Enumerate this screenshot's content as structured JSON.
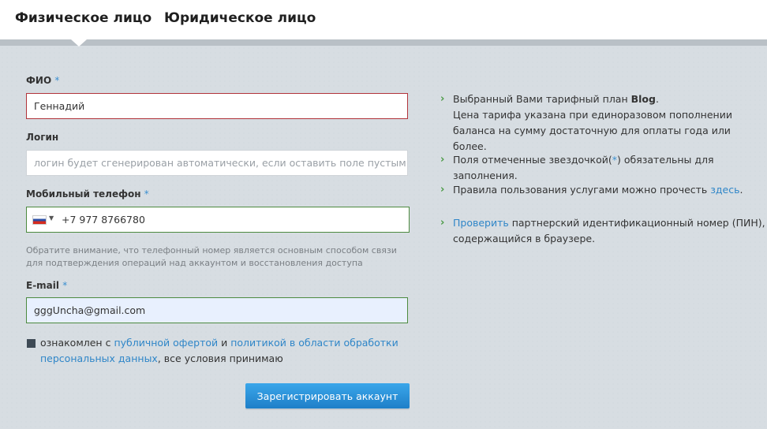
{
  "tabs": [
    {
      "label": "Физическое лицо",
      "active": true
    },
    {
      "label": "Юридическое лицо",
      "active": false
    }
  ],
  "form": {
    "required_mark": "*",
    "fio": {
      "label": "ФИО",
      "value": "Геннадий"
    },
    "login": {
      "label": "Логин",
      "value": "",
      "placeholder": "логин будет сгенерирован автоматически, если оставить поле пустым"
    },
    "phone": {
      "label": "Мобильный телефон",
      "value": "+7 977 8766780",
      "country_icon": "russia-flag-icon"
    },
    "phone_hint": "Обратите внимание, что телефонный номер является основным способом связи для подтверждения операций над аккаунтом и восстановления доступа",
    "email": {
      "label": "E-mail",
      "value": "gggUncha@gmail.com"
    },
    "agree": {
      "prefix": "ознакомлен с ",
      "link1": "публичной офертой",
      "mid": " и ",
      "link2": "политикой в области обработки персональных данных",
      "suffix": ", все условия принимаю"
    },
    "submit_label": "Зарегистрировать аккаунт"
  },
  "info": {
    "tariff": {
      "prefix": "Выбранный Вами тарифный план ",
      "plan": "Blog",
      "suffix": ".",
      "note": "Цена тарифа указана при единоразовом пополнении баланса на сумму достаточную для оплаты года или более."
    },
    "required": {
      "prefix": "Поля отмеченные звездочкой(",
      "star": "*",
      "suffix": ") обязательны для заполнения."
    },
    "rules": {
      "prefix": "Правила пользования услугами можно прочесть ",
      "link": "здесь",
      "suffix": "."
    },
    "pin": {
      "link": "Проверить",
      "suffix": " партнерский идентификационный номер (ПИН), содержащийся в браузере."
    }
  },
  "colors": {
    "accent": "#2f86c8",
    "error_border": "#b1333a",
    "ok_border": "#4c8a3f",
    "bullet": "#4a9a45"
  }
}
